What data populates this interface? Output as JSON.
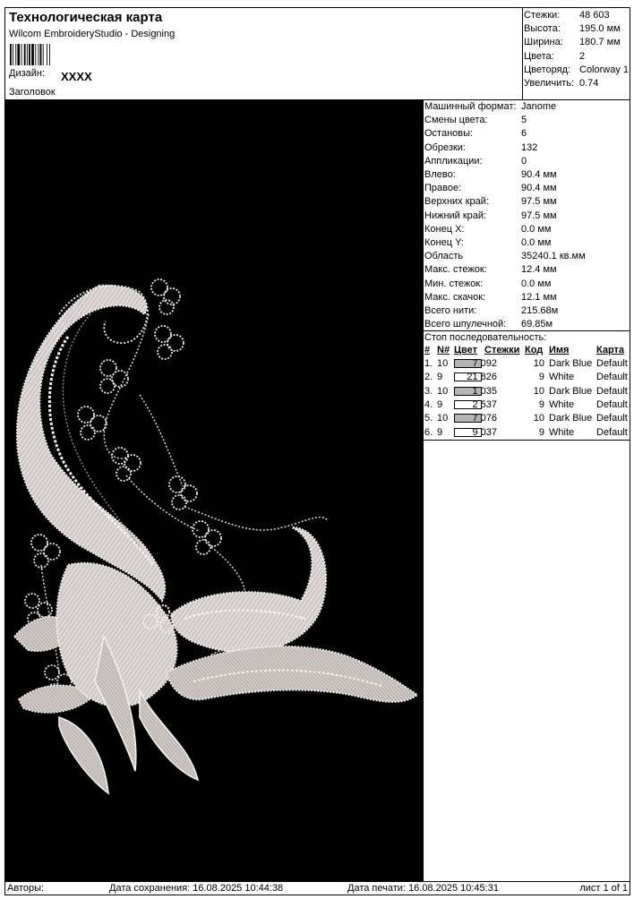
{
  "header": {
    "title": "Технологическая карта",
    "app_name": "Wilcom EmbroideryStudio - Designing",
    "design_label": "Дизайн:",
    "design_value": "XXXX",
    "heading_label": "Заголовок"
  },
  "summary": [
    {
      "label": "Стежки:",
      "value": "48 603"
    },
    {
      "label": "Высота:",
      "value": "195.0 мм"
    },
    {
      "label": "Ширина:",
      "value": "180.7 мм"
    },
    {
      "label": "Цвета:",
      "value": "2"
    },
    {
      "label": "Цветоряд:",
      "value": "Colorway 1"
    },
    {
      "label": "Увеличить:",
      "value": "0.74"
    }
  ],
  "details": [
    {
      "label": "Машинный формат:",
      "value": "Janome"
    },
    {
      "label": "Смены цвета:",
      "value": "5"
    },
    {
      "label": "Остановы:",
      "value": "6"
    },
    {
      "label": "Обрезки:",
      "value": "132"
    },
    {
      "label": "Аппликации:",
      "value": "0"
    },
    {
      "label": "Влево:",
      "value": "90.4 мм"
    },
    {
      "label": "Правое:",
      "value": "90.4 мм"
    },
    {
      "label": "Верхних край:",
      "value": "97.5 мм"
    },
    {
      "label": "Нижний край:",
      "value": "97.5 мм"
    },
    {
      "label": "Конец X:",
      "value": "0.0 мм"
    },
    {
      "label": "Конец Y:",
      "value": "0.0 мм"
    },
    {
      "label": "Область",
      "value": "35240.1 кв.мм"
    },
    {
      "label": "Макс. стежок:",
      "value": "12.4 мм"
    },
    {
      "label": "Мин. стежок:",
      "value": "0.0 мм"
    },
    {
      "label": "Макс. скачок:",
      "value": "12.1 мм"
    },
    {
      "label": "Всего нити:",
      "value": "215.68м"
    },
    {
      "label": "Всего шпулечной:",
      "value": "69.85м"
    }
  ],
  "stop_sequence": {
    "label": "Стоп последовательность:",
    "headers": {
      "idx": "#",
      "n": "N#",
      "color": "Цвет",
      "stitches": "Стежки",
      "code": "Код",
      "name": "Имя",
      "chart": "Карта"
    },
    "rows": [
      {
        "idx": "1.",
        "n": "10",
        "color": "#b4b4b4",
        "stitches": "7 092",
        "code": "10",
        "name": "Dark Blue",
        "chart": "Default"
      },
      {
        "idx": "2.",
        "n": "9",
        "color": "#ffffff",
        "stitches": "21 826",
        "code": "9",
        "name": "White",
        "chart": "Default"
      },
      {
        "idx": "3.",
        "n": "10",
        "color": "#b4b4b4",
        "stitches": "1 035",
        "code": "10",
        "name": "Dark Blue",
        "chart": "Default"
      },
      {
        "idx": "4.",
        "n": "9",
        "color": "#ffffff",
        "stitches": "2 537",
        "code": "9",
        "name": "White",
        "chart": "Default"
      },
      {
        "idx": "5.",
        "n": "10",
        "color": "#b4b4b4",
        "stitches": "7 076",
        "code": "10",
        "name": "Dark Blue",
        "chart": "Default"
      },
      {
        "idx": "6.",
        "n": "9",
        "color": "#ffffff",
        "stitches": "9 037",
        "code": "9",
        "name": "White",
        "chart": "Default"
      }
    ]
  },
  "footer": {
    "authors": "Авторы:",
    "saved": "Дата сохранения: 16.08.2025 10:44:38",
    "printed": "Дата печати: 16.08.2025 10:45:31",
    "page": "лист 1 of 1"
  },
  "preview": {
    "background": "#000000",
    "thread_light": "#e8e4e2",
    "thread_mid": "#b8b0ae"
  }
}
